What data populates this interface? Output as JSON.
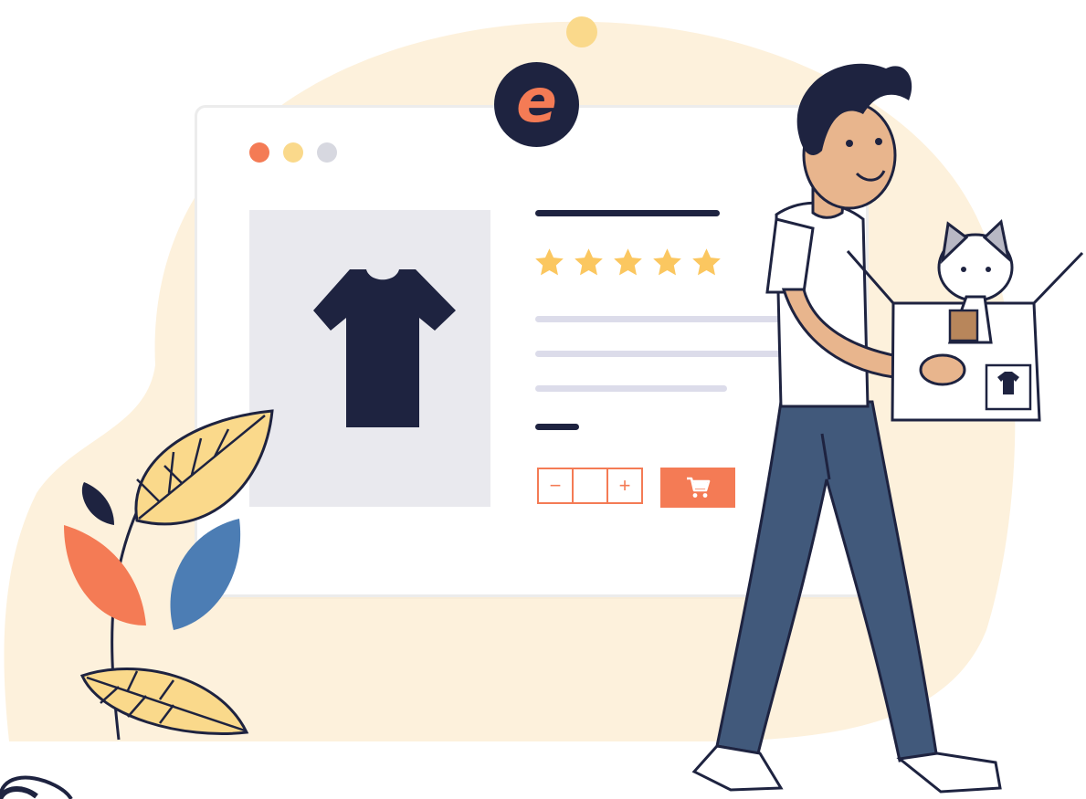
{
  "illustration": {
    "logo_letter": "e",
    "window_controls": [
      "close",
      "minimize",
      "maximize"
    ],
    "product": {
      "image_icon": "t-shirt-icon",
      "rating": 5,
      "rating_max": 5
    },
    "quantity": {
      "decrement_label": "−",
      "value": "",
      "increment_label": "+"
    },
    "cart_icon": "shopping-cart-icon",
    "colors": {
      "accent": "#f47b55",
      "navy": "#1e2340",
      "star": "#fbc760",
      "blob": "#fdf1dc",
      "leaf_yellow": "#fad98b",
      "leaf_blue": "#4c7db4",
      "pants": "#41597b"
    }
  }
}
